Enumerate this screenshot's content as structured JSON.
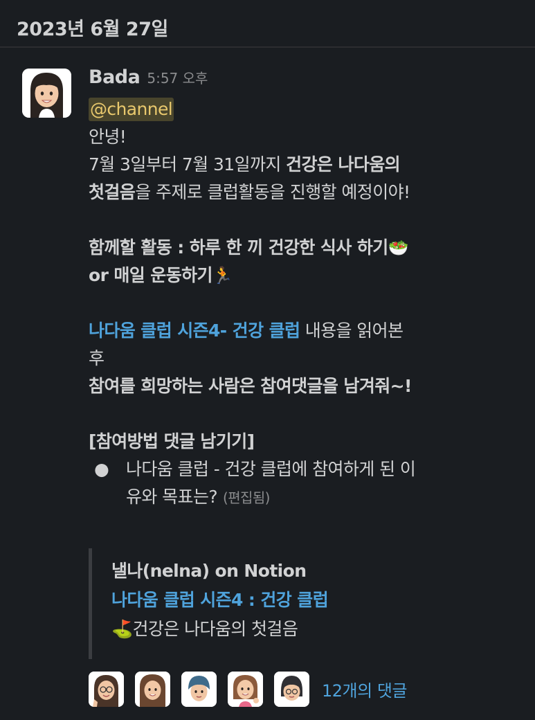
{
  "date_header": "2023년 6월 27일",
  "message": {
    "author": "Bada",
    "time": "5:57 오후",
    "mention": "@channel",
    "greeting": "안녕!",
    "line1_prefix": "7월 3일부터 7월 31일까지 ",
    "line1_bold": "건강은 나다움의",
    "line2_bold": "첫걸음",
    "line2_rest": "을 주제로 클럽활동을 진행할 예정이야!",
    "activity_line1": "함께할 활동 : 하루 한 끼 건강한 식사 하기",
    "activity_emoji1": "🥗",
    "activity_line2": "or 매일 운동하기",
    "activity_emoji2": "🏃",
    "club_link": "나다움 클럽 시즌4- 건강 클럽",
    "club_link_rest": " 내용을 읽어본",
    "club_link_wrap": "후",
    "join_line": "참여를 희망하는 사람은 참여댓글을 남겨줘~!",
    "method_title": "[참여방법 댓글 남기기]",
    "bullet_dot": "●",
    "bullet_line1": "나다움 클럽 - 건강 클럽에 참여하게 된 이",
    "bullet_line2": "유와 목표는?",
    "edited": "(편집됨)"
  },
  "attachment": {
    "source": "낼나(nelna) on Notion",
    "title": "나다움 클럽 시즌4 : 건강 클럽",
    "emoji": "⛳",
    "description": "건강은 나다움의 첫걸음"
  },
  "replies": {
    "count_label": "12개의 댓글",
    "avatars": [
      "memoji-1",
      "memoji-2",
      "memoji-3",
      "memoji-4",
      "memoji-5"
    ]
  },
  "colors": {
    "background": "#1a1d21",
    "link": "#4fa3dc",
    "mention_text": "#e8c86d",
    "mention_bg": "#49452c"
  }
}
